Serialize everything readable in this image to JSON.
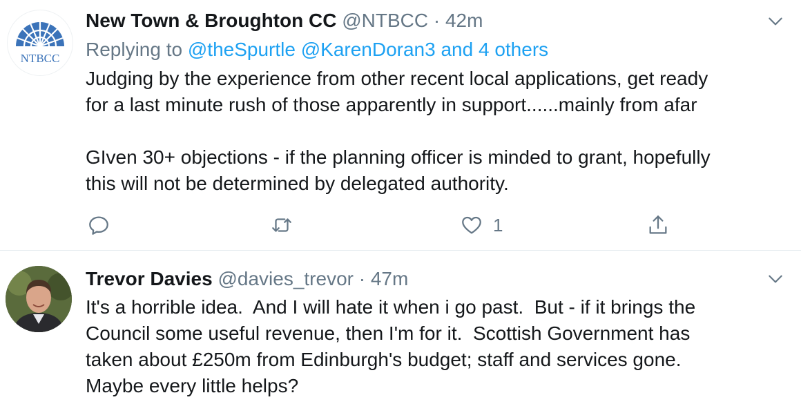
{
  "tweets": [
    {
      "author_name": "New Town & Broughton CC",
      "handle": "@NTBCC",
      "separator": "·",
      "time": "42m",
      "avatar_text": "NTBCC",
      "replying_prefix": "Replying to",
      "replying_to": "@theSpurtle @KarenDoran3 and 4 others",
      "text": "Judging by the experience from other recent local applications, get ready\nfor a last minute rush of those apparently in support......mainly from afar\n\nGIven 30+ objections - if the planning officer is minded to grant, hopefully\nthis will not be determined by delegated authority.",
      "like_count": "1",
      "icons": [
        "reply-icon",
        "retweet-icon",
        "like-icon",
        "share-icon",
        "chevron-down-icon"
      ]
    },
    {
      "author_name": "Trevor Davies",
      "handle": "@davies_trevor",
      "separator": "·",
      "time": "47m",
      "text": "It's a horrible idea.  And I will hate it when i go past.  But - if it brings the\nCouncil some useful revenue, then I'm for it.  Scottish Government has\ntaken about £250m from Edinburgh's budget; staff and services gone.\nMaybe every little helps?",
      "icons": [
        "chevron-down-icon"
      ]
    }
  ],
  "colors": {
    "text": "#14171a",
    "secondary": "#657786",
    "link": "#1da1f2",
    "logo_blue": "#3b73b9",
    "divider": "#e6ecf0"
  }
}
